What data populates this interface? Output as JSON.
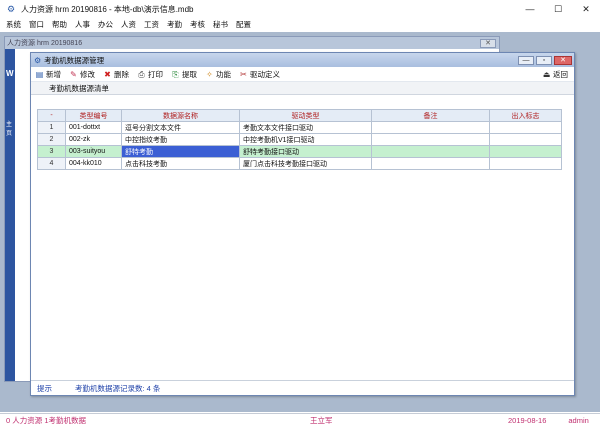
{
  "app": {
    "title": "人力资源 hrm 20190816 - 本地-db\\演示信息.mdb",
    "window_buttons": {
      "minimize": "—",
      "maximize": "☐",
      "close": "✕"
    }
  },
  "menu": [
    "系统",
    "窗口",
    "帮助",
    "人事",
    "办公",
    "人资",
    "工资",
    "考勤",
    "考核",
    "秘书",
    "配置"
  ],
  "outer_window": {
    "title": "人力资源 hrm 20190816",
    "left_letter": "W",
    "left_label": "主页"
  },
  "inner_window": {
    "title": "考勤机数据源管理",
    "toolbar": [
      {
        "id": "new",
        "label": "新增",
        "icon": "new-icon",
        "glyph": "▤"
      },
      {
        "id": "edit",
        "label": "修改",
        "icon": "edit-icon",
        "glyph": "✎"
      },
      {
        "id": "delete",
        "label": "删除",
        "icon": "delete-icon",
        "glyph": "✖"
      },
      {
        "id": "print",
        "label": "打印",
        "icon": "print-icon",
        "glyph": "⎙"
      },
      {
        "id": "extract",
        "label": "提取",
        "icon": "extract-icon",
        "glyph": "⎘"
      },
      {
        "id": "function",
        "label": "功能",
        "icon": "function-icon",
        "glyph": "✧"
      },
      {
        "id": "driver-def",
        "label": "驱动定义",
        "icon": "wrench-icon",
        "glyph": "✂"
      }
    ],
    "back_label": "返回",
    "panel_title": "考勤机数据源清单",
    "table": {
      "corner": "-",
      "columns": [
        "类型编号",
        "数据源名称",
        "驱动类型",
        "备注",
        "出入标志"
      ],
      "rows": [
        {
          "no": "1",
          "code": "001-dottxt",
          "name": "逗号分割文本文件",
          "driver": "考勤文本文件接口驱动",
          "note": "",
          "flag": ""
        },
        {
          "no": "2",
          "code": "002-zk",
          "name": "中控指纹考勤",
          "driver": "中控考勤机V1接口驱动",
          "note": "",
          "flag": ""
        },
        {
          "no": "3",
          "code": "003-suityou",
          "name": "舒特考勤",
          "driver": "舒特考勤接口驱动",
          "note": "",
          "flag": ""
        },
        {
          "no": "4",
          "code": "004-kk010",
          "name": "点击科技考勤",
          "driver": "厦门点击科技考勤接口驱动",
          "note": "",
          "flag": ""
        }
      ],
      "selected_row": 2
    },
    "status": {
      "hint": "提示",
      "count": "考勤机数据源记录数: 4 条"
    }
  },
  "bottom_bar": {
    "module": "0 人力资源  1考勤机数据",
    "user": "王立军",
    "date": "2019-08-16",
    "role": "admin"
  },
  "colors": {
    "mdi_bg": "#aab9cd",
    "header_text": "#b02020",
    "selected_row": "#c5f0cf",
    "current_cell": "#3b5fd4"
  }
}
